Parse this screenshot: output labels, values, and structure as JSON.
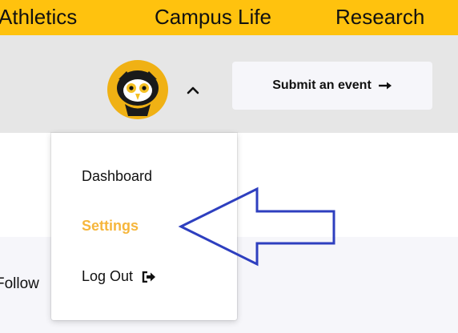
{
  "colors": {
    "accent_yellow": "#FFC20E",
    "subbar_gray": "#E6E6E6",
    "menu_active": "#F6B63C",
    "annotation_arrow": "#2E3FBF"
  },
  "topnav": {
    "items": [
      {
        "label": "Athletics"
      },
      {
        "label": "Campus Life"
      },
      {
        "label": "Research"
      }
    ]
  },
  "header": {
    "avatar_icon": "owl-mascot-avatar",
    "caret_icon": "chevron-up-icon",
    "submit_label": "Submit an event",
    "submit_icon": "arrow-right-icon"
  },
  "dropdown": {
    "items": [
      {
        "label": "Dashboard",
        "active": false
      },
      {
        "label": "Settings",
        "active": true
      },
      {
        "label": "Log Out",
        "active": false,
        "icon": "sign-out-icon"
      }
    ]
  },
  "page": {
    "follow_partial": "Follow"
  },
  "annotation": {
    "type": "arrow",
    "direction": "left",
    "points_to": "Settings"
  }
}
